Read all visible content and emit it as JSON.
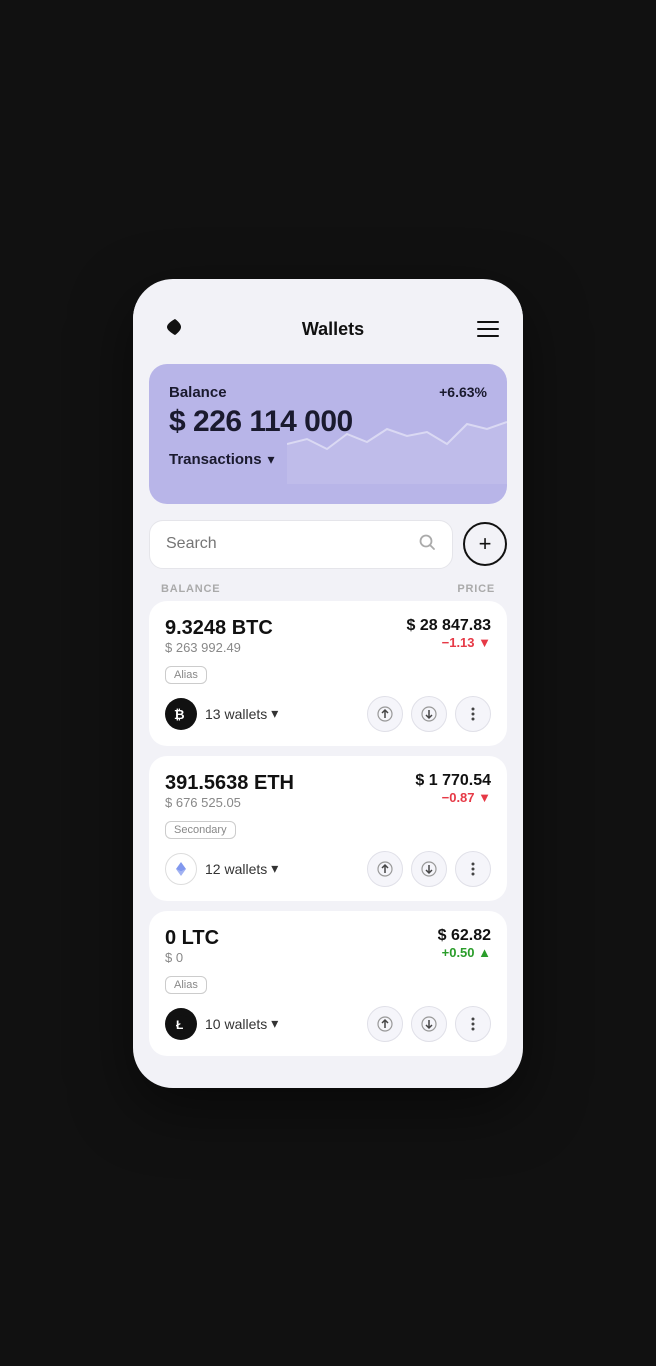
{
  "header": {
    "title": "Wallets",
    "menu_label": "menu"
  },
  "balance_card": {
    "label": "Balance",
    "amount": "$ 226 114 000",
    "percent": "+6.63%",
    "transactions_label": "Transactions"
  },
  "search": {
    "placeholder": "Search"
  },
  "columns": {
    "balance": "BALANCE",
    "price": "PRICE"
  },
  "coins": [
    {
      "amount": "9.3248 BTC",
      "usd_value": "$ 263 992.49",
      "price": "$ 28 847.83",
      "change": "−1.13 ▼",
      "change_type": "negative",
      "alias": "Alias",
      "wallets": "13 wallets",
      "icon": "₿",
      "icon_style": "btc"
    },
    {
      "amount": "391.5638 ETH",
      "usd_value": "$ 676 525.05",
      "price": "$ 1 770.54",
      "change": "−0.87 ▼",
      "change_type": "negative",
      "alias": "Secondary",
      "wallets": "12 wallets",
      "icon": "⬡",
      "icon_style": "eth"
    },
    {
      "amount": "0 LTC",
      "usd_value": "$ 0",
      "price": "$ 62.82",
      "change": "+0.50 ▲",
      "change_type": "positive",
      "alias": "Alias",
      "wallets": "10 wallets",
      "icon": "Ł",
      "icon_style": "ltc"
    }
  ],
  "add_button_label": "+"
}
